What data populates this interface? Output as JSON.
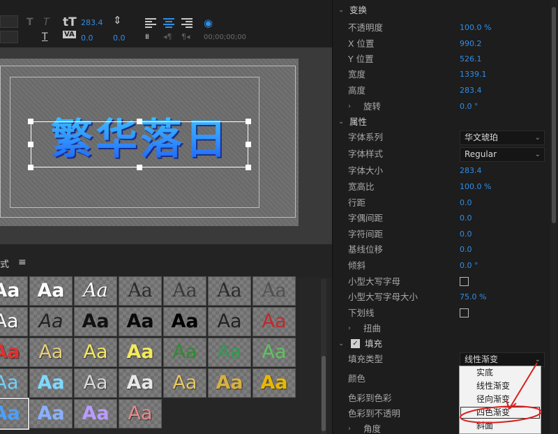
{
  "toolbar": {
    "font_size_value": "283.4",
    "tracking_value": "0.0",
    "leading_value": "0.0",
    "timecode": "00;00;00;00",
    "tsume_label": "VA",
    "text_icon": "T"
  },
  "monitor": {
    "title_text": "繁华落日"
  },
  "styles": {
    "panel_title": "式",
    "menu_icon": "≡",
    "cell_text": "Aa"
  },
  "properties": {
    "transform": {
      "section": "变换",
      "opacity_label": "不透明度",
      "opacity_value": "100.0 %",
      "x_label": "X 位置",
      "x_value": "990.2",
      "y_label": "Y 位置",
      "y_value": "526.1",
      "width_label": "宽度",
      "width_value": "1339.1",
      "height_label": "高度",
      "height_value": "283.4",
      "rotation_label": "旋转",
      "rotation_value": "0.0 °"
    },
    "attributes": {
      "section": "属性",
      "font_family_label": "字体系列",
      "font_family_value": "华文琥珀",
      "font_style_label": "字体样式",
      "font_style_value": "Regular",
      "font_size_label": "字体大小",
      "font_size_value": "283.4",
      "aspect_label": "宽高比",
      "aspect_value": "100.0 %",
      "leading_label": "行距",
      "leading_value": "0.0",
      "kerning_label": "字偶间距",
      "kerning_value": "0.0",
      "tracking_label": "字符间距",
      "tracking_value": "0.0",
      "baseline_label": "基线位移",
      "baseline_value": "0.0",
      "slant_label": "倾斜",
      "slant_value": "0.0 °",
      "small_caps_label": "小型大写字母",
      "small_caps_size_label": "小型大写字母大小",
      "small_caps_size_value": "75.0 %",
      "underline_label": "下划线",
      "distort_label": "扭曲"
    },
    "fill": {
      "section": "填充",
      "fill_type_label": "填充类型",
      "fill_type_value": "线性渐变",
      "color_label": "颜色",
      "color_to_color_label": "色彩到色彩",
      "color_to_opacity_label": "色彩到不透明",
      "angle_label": "角度",
      "options": [
        "实底",
        "线性渐变",
        "径向渐变",
        "四色渐变",
        "斜面"
      ]
    }
  },
  "colors": {
    "accent_blue": "#2f8fe8",
    "annotation_red": "#d9201e"
  }
}
